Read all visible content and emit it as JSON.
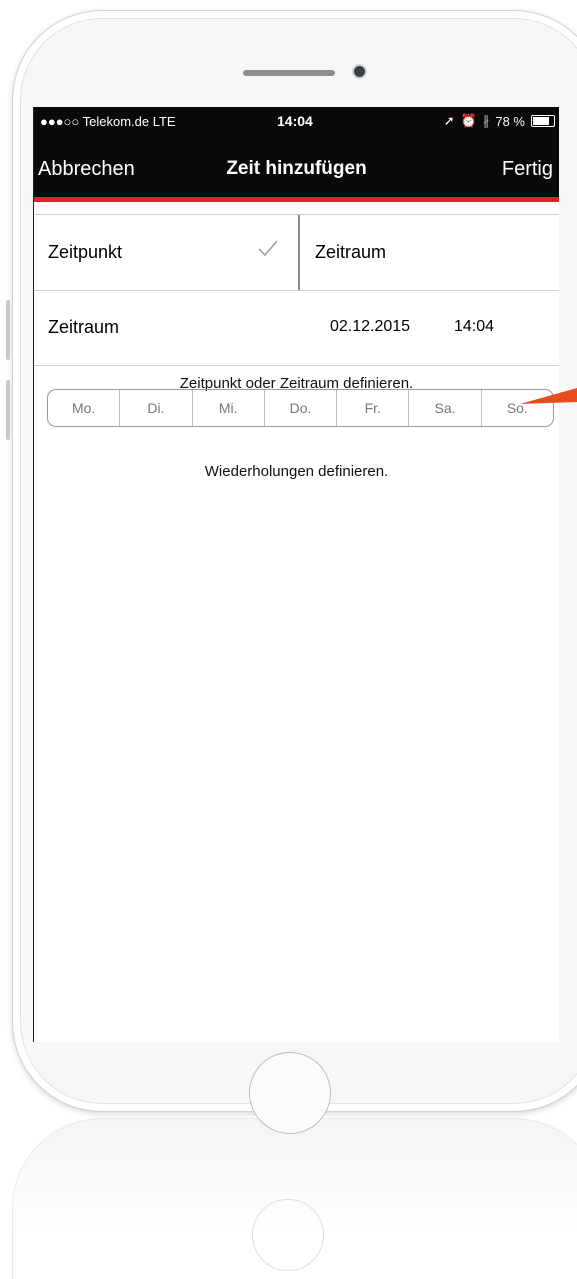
{
  "status_bar": {
    "carrier": "●●●○○ Telekom.de  LTE",
    "time": "14:04",
    "battery": "78 %",
    "battery_level": 0.78
  },
  "nav": {
    "cancel_label": "Abbrechen",
    "title": "Zeit hinzufügen",
    "done_label": "Fertig",
    "accent_color": "#e3202a"
  },
  "segment": {
    "left_label": "Zeitpunkt",
    "right_label": "Zeitraum",
    "selected": "Zeitpunkt"
  },
  "zeitraum_row": {
    "label": "Zeitraum",
    "date": "02.12.2015",
    "time": "14:04"
  },
  "hint_time": "Zeitpunkt oder Zeitraum definieren.",
  "weekdays": [
    "Mo.",
    "Di.",
    "Mi.",
    "Do.",
    "Fr.",
    "Sa.",
    "So."
  ],
  "hint_repeat": "Wiederholungen definieren."
}
